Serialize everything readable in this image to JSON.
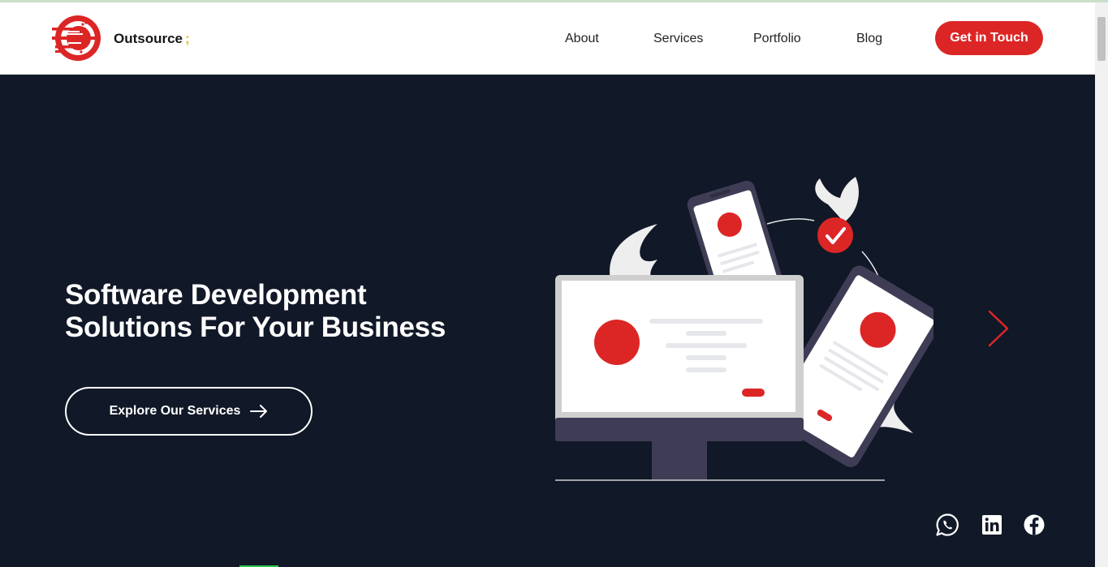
{
  "brand": {
    "name": "Outsource",
    "mark": ";",
    "logo_color": "#dc2626",
    "mark_color": "#f2b705"
  },
  "nav": {
    "items": [
      "About",
      "Services",
      "Portfolio",
      "Blog"
    ],
    "cta": "Get in Touch"
  },
  "hero": {
    "title_line1": "Software Development",
    "title_line2": "Solutions For Your Business",
    "button_label": "Explore Our Services",
    "background": "#111827",
    "accent": "#dc2626"
  },
  "icons": {
    "button_arrow": "arrow-right-icon",
    "slider_next": "chevron-right-icon",
    "social": [
      "whatsapp-icon",
      "linkedin-icon",
      "facebook-icon"
    ]
  }
}
